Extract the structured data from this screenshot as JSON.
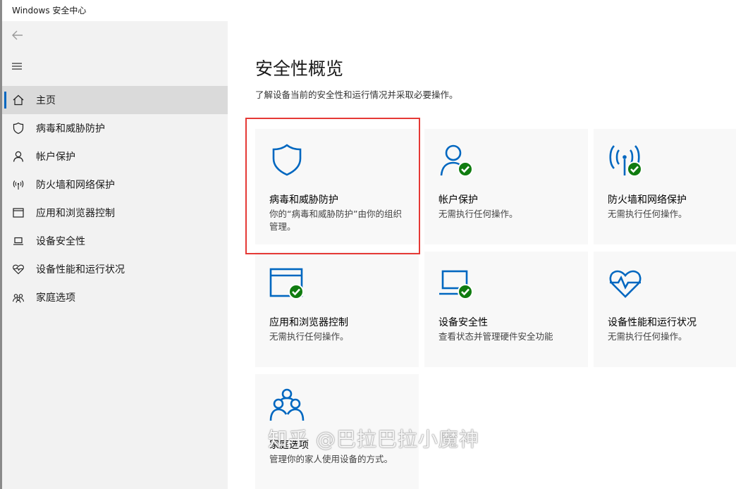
{
  "window": {
    "title": "Windows 安全中心"
  },
  "sidebar": {
    "items": [
      {
        "label": "主页",
        "icon": "home-icon",
        "active": true
      },
      {
        "label": "病毒和威胁防护",
        "icon": "shield-icon"
      },
      {
        "label": "帐户保护",
        "icon": "person-icon"
      },
      {
        "label": "防火墙和网络保护",
        "icon": "wifi-signal-icon"
      },
      {
        "label": "应用和浏览器控制",
        "icon": "app-window-icon"
      },
      {
        "label": "设备安全性",
        "icon": "laptop-icon"
      },
      {
        "label": "设备性能和运行状况",
        "icon": "heart-icon"
      },
      {
        "label": "家庭选项",
        "icon": "family-icon"
      }
    ]
  },
  "main": {
    "title": "安全性概览",
    "subtitle": "了解设备当前的安全性和运行情况并采取必要操作。",
    "tiles": [
      {
        "name": "病毒和威胁防护",
        "desc": "你的“病毒和威胁防护”由你的组织管理。",
        "icon": "shield-icon"
      },
      {
        "name": "帐户保护",
        "desc": "无需执行任何操作。",
        "icon": "person-check-icon"
      },
      {
        "name": "防火墙和网络保护",
        "desc": "无需执行任何操作。",
        "icon": "antenna-check-icon"
      },
      {
        "name": "应用和浏览器控制",
        "desc": "无需执行任何操作。",
        "icon": "app-window-check-icon"
      },
      {
        "name": "设备安全性",
        "desc": "查看状态并管理硬件安全功能",
        "icon": "laptop-check-icon"
      },
      {
        "name": "设备性能和运行状况",
        "desc": "无需执行任何操作。",
        "icon": "heart-pulse-icon"
      },
      {
        "name": "家庭选项",
        "desc": "管理你的家人使用设备的方式。",
        "icon": "family-icon"
      }
    ]
  },
  "watermark": "知乎 @巴拉巴拉小魔神",
  "colors": {
    "accent": "#0067c0",
    "ok": "#107c10",
    "highlight": "#e53935"
  }
}
